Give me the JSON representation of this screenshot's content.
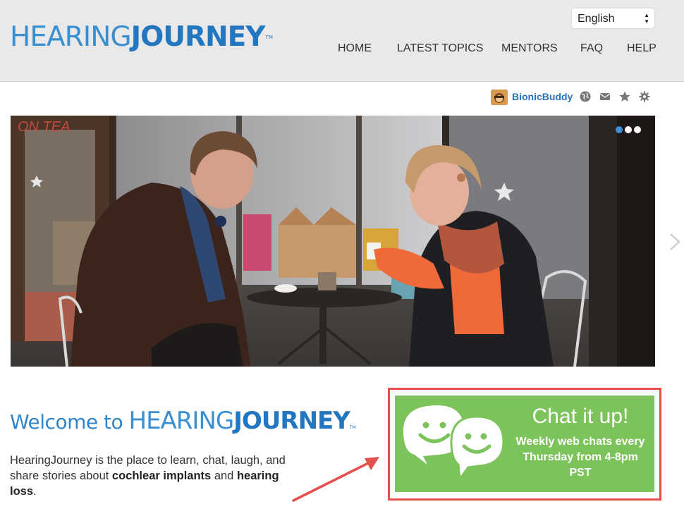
{
  "header": {
    "logo": {
      "thin": "HEARING",
      "bold": "JOURNEY",
      "tm": "TM"
    },
    "language": {
      "selected": "English"
    },
    "nav": [
      {
        "label": "HOME"
      },
      {
        "label": "LATEST TOPICS"
      },
      {
        "label": "MENTORS"
      },
      {
        "label": "FAQ"
      },
      {
        "label": "HELP"
      }
    ]
  },
  "userbar": {
    "username": "BionicBuddy",
    "icons": [
      "globe-icon",
      "mail-icon",
      "star-icon",
      "gear-icon"
    ]
  },
  "hero": {
    "slide_count": 3,
    "active_slide": 1,
    "sign_text": "ON TEA"
  },
  "welcome": {
    "prefix": "Welcome to ",
    "brand_thin": "HEARING",
    "brand_bold": "JOURNEY",
    "tm": "TM"
  },
  "intro": {
    "part1": "HearingJourney is the place to learn, chat, laugh, and share stories about ",
    "bold1": "cochlear implants",
    "part2": " and ",
    "bold2": "hearing loss",
    "part3": "."
  },
  "chat": {
    "title": "Chat it up!",
    "line1": "Weekly web chats every",
    "line2": "Thursday from 4-8pm",
    "line3": "PST"
  },
  "colors": {
    "brand_blue": "#2277c0",
    "chat_green": "#7dc35b",
    "highlight_red": "#e4504b",
    "header_bg": "#e9e9e9"
  }
}
